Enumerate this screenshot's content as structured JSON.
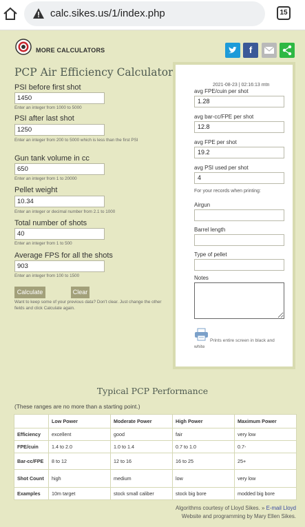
{
  "browser": {
    "url": "calc.sikes.us/1/index.php",
    "tab_count": "15"
  },
  "header": {
    "more_calculators": "MORE CALCULATORS",
    "share_buttons": [
      "twitter-share",
      "facebook-share",
      "email-share",
      "share"
    ]
  },
  "page": {
    "title": "PCP Air Efficiency Calculator"
  },
  "form": {
    "fields": [
      {
        "label": "PSI before first shot",
        "value": "1450",
        "hint": "Enter an integer from 1000 to 5000"
      },
      {
        "label": "PSI after last shot",
        "value": "1250",
        "hint": "Enter an integer from 200 to 5000 which is less than the first PSI"
      },
      {
        "label": "Gun tank volume in cc",
        "value": "650",
        "hint": "Enter an integer from 1 to 20000"
      },
      {
        "label": "Pellet weight",
        "value": "10.34",
        "hint": "Enter an integer or decimal number from 2.1 to 1000"
      },
      {
        "label": "Total number of shots",
        "value": "40",
        "hint": "Enter an integer from 1 to 500"
      },
      {
        "label": "Average FPS for all the shots",
        "value": "903",
        "hint": "Enter an integer from 100 to 1500"
      }
    ],
    "calculate_label": "Calculate",
    "clear_label": "Clear",
    "keep_note": "Want to keep some of your previous data? Don't clear. Just change the other fields and click Calculate again."
  },
  "results": {
    "timestamp": "2021-08-23 | 02:16:13 mtn",
    "items": [
      {
        "label": "avg FPE/cuin per shot",
        "value": "1.28"
      },
      {
        "label": "avg bar-cc/FPE per shot",
        "value": "12.8"
      },
      {
        "label": "avg FPE per shot",
        "value": "19.2"
      },
      {
        "label": "avg PSI used per shot",
        "value": "4"
      }
    ],
    "records_note": "For your records when printing:",
    "airgun_label": "Airgun",
    "barrel_label": "Barrel length",
    "pellet_label": "Type of pellet",
    "notes_label": "Notes",
    "print_note": "Prints entire screen in black and white"
  },
  "performance": {
    "title": "Typical PCP Performance",
    "subtitle": "(These ranges are no more than a starting point.)",
    "columns": [
      "",
      "Low Power",
      "Moderate Power",
      "High Power",
      "Maximum Power"
    ],
    "rows": [
      [
        "Efficiency",
        "excellent",
        "good",
        "fair",
        "very low"
      ],
      [
        "FPE/cuin",
        "1.4 to 2.0",
        "1.0 to 1.4",
        "0.7 to 1.0",
        "0.7-"
      ],
      [
        "Bar-cc/FPE",
        "8 to 12",
        "12 to 16",
        "16 to 25",
        "25+"
      ],
      [
        "Shot Count",
        "high",
        "medium",
        "low",
        "very low"
      ],
      [
        "Examples",
        "10m target",
        "stock small caliber",
        "stock big bore",
        "modded big bore"
      ]
    ]
  },
  "credits": {
    "line1_prefix": "Algorithms courtesy of Lloyd Sikes. »",
    "email_link": "E-mail Lloyd",
    "line2": "Website and programming by Mary Ellen Sikes."
  }
}
